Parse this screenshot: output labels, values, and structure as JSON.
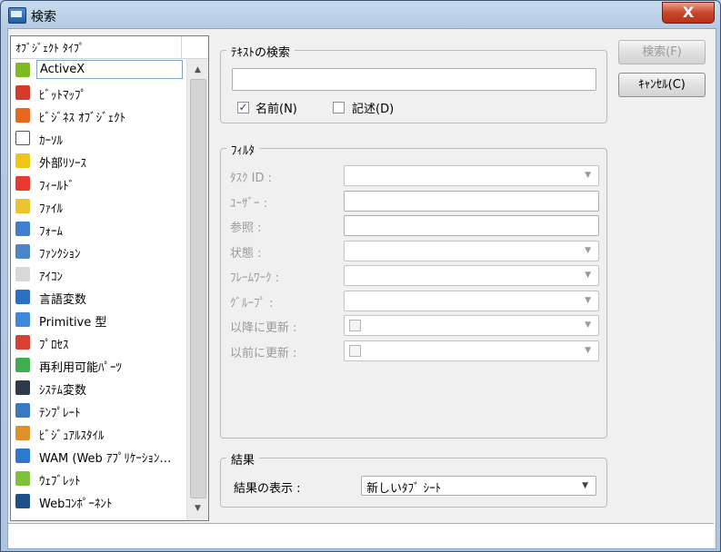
{
  "window": {
    "title": "検索",
    "close_glyph": "X"
  },
  "type_list": {
    "header": "ｵﾌﾞｼﾞｪｸﾄ ﾀｲﾌﾟ",
    "items": [
      {
        "label": "ActiveX",
        "icon": "activex-icon",
        "color": "#7cbb22"
      },
      {
        "label": "ﾋﾞｯﾄﾏｯﾌﾟ",
        "icon": "bitmap-icon",
        "color": "#d63b2a"
      },
      {
        "label": "ﾋﾞｼﾞﾈｽ ｵﾌﾞｼﾞｪｸﾄ",
        "icon": "business-object-icon",
        "color": "#e8661e"
      },
      {
        "label": "ｶｰｿﾙ",
        "icon": "cursor-icon",
        "color": "#ffffff"
      },
      {
        "label": "外部ﾘｿｰｽ",
        "icon": "external-resource-icon",
        "color": "#f2c418"
      },
      {
        "label": "ﾌｨｰﾙﾄﾞ",
        "icon": "field-icon",
        "color": "#e63b2e"
      },
      {
        "label": "ﾌｧｲﾙ",
        "icon": "file-icon",
        "color": "#e9c42a"
      },
      {
        "label": "ﾌｫｰﾑ",
        "icon": "form-icon",
        "color": "#3f7fd0"
      },
      {
        "label": "ﾌｧﾝｸｼｮﾝ",
        "icon": "function-icon",
        "color": "#4a86c8"
      },
      {
        "label": "ｱｲｺﾝ",
        "icon": "icon-resource-icon",
        "color": "#d8d8d8"
      },
      {
        "label": "言語変数",
        "icon": "language-variable-icon",
        "color": "#2d6fc0"
      },
      {
        "label": "Primitive 型",
        "icon": "primitive-type-icon",
        "color": "#3a8ad6"
      },
      {
        "label": "ﾌﾟﾛｾｽ",
        "icon": "process-icon",
        "color": "#d8412e"
      },
      {
        "label": "再利用可能ﾊﾟｰﾂ",
        "icon": "reusable-part-icon",
        "color": "#3cae4c"
      },
      {
        "label": "ｼｽﾃﾑ変数",
        "icon": "system-variable-icon",
        "color": "#2d3a4a"
      },
      {
        "label": "ﾃﾝﾌﾟﾚｰﾄ",
        "icon": "template-icon",
        "color": "#3a78c4"
      },
      {
        "label": "ﾋﾞｼﾞｭｱﾙｽﾀｲﾙ",
        "icon": "visual-style-icon",
        "color": "#e0902a"
      },
      {
        "label": "WAM (Web ｱﾌﾟﾘｹｰｼｮﾝ…",
        "icon": "wam-icon",
        "color": "#2f78d0"
      },
      {
        "label": "ｳｪﾌﾞﾚｯﾄ",
        "icon": "weblet-icon",
        "color": "#7cc23a"
      },
      {
        "label": "Webｺﾝﾎﾟｰﾈﾝﾄ",
        "icon": "web-component-icon",
        "color": "#1d4f8a"
      }
    ]
  },
  "text_search": {
    "title": "ﾃｷｽﾄの検索",
    "query": "",
    "name_label": "名前(N)",
    "name_checked": true,
    "desc_label": "記述(D)",
    "desc_checked": false
  },
  "filter": {
    "title": "ﾌｨﾙﾀ",
    "fields": [
      {
        "label": "ﾀｽｸ ID :",
        "kind": "combo"
      },
      {
        "label": "ﾕｰｻﾞｰ :",
        "kind": "text"
      },
      {
        "label": "参照 :",
        "kind": "text"
      },
      {
        "label": "状態 :",
        "kind": "combo"
      },
      {
        "label": "ﾌﾚｰﾑﾜｰｸ :",
        "kind": "combo"
      },
      {
        "label": "ｸﾞﾙｰﾌﾟ :",
        "kind": "combo"
      },
      {
        "label": "以降に更新 :",
        "kind": "date"
      },
      {
        "label": "以前に更新 :",
        "kind": "date"
      }
    ]
  },
  "results": {
    "title": "結果",
    "display_label": "結果の表示 :",
    "display_value": "新しいﾀﾌﾞ ｼｰﾄ"
  },
  "buttons": {
    "search": "検索(F)",
    "cancel": "ｷｬﾝｾﾙ(C)"
  },
  "status_text": ""
}
